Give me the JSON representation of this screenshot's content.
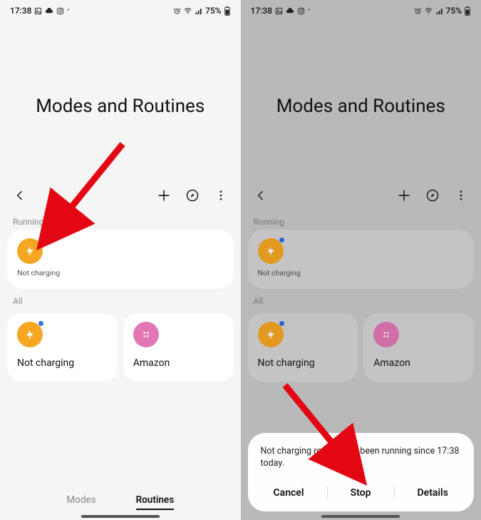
{
  "status": {
    "time": "17:38",
    "battery_pct": "75%"
  },
  "header": {
    "title": "Modes and Routines"
  },
  "sections": {
    "running_label": "Running",
    "all_label": "All"
  },
  "running": {
    "name": "Not charging"
  },
  "routines": [
    {
      "name": "Not charging"
    },
    {
      "name": "Amazon"
    }
  ],
  "tabs": {
    "modes": "Modes",
    "routines": "Routines"
  },
  "sheet": {
    "message": "Not charging routine has been running since 17:38 today.",
    "cancel": "Cancel",
    "stop": "Stop",
    "details": "Details"
  }
}
